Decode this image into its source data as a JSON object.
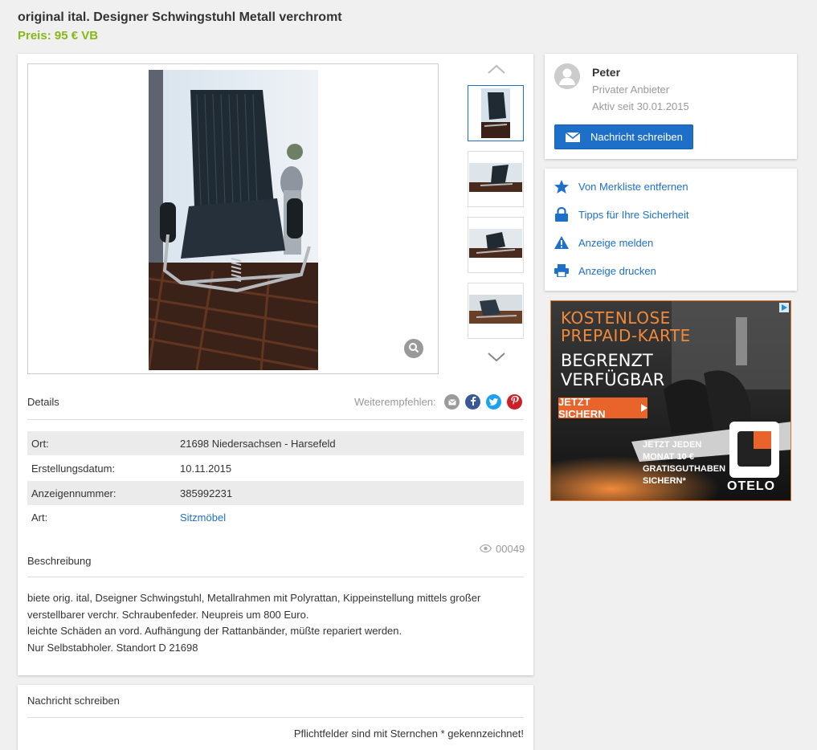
{
  "listing": {
    "title": "original ital. Designer Schwingstuhl Metall verchromt",
    "price": "Preis: 95 € VB"
  },
  "details": {
    "heading": "Details",
    "share_label": "Weiterempfehlen:",
    "rows": [
      {
        "label": "Ort:",
        "value": "21698 Niedersachsen - Harsefeld"
      },
      {
        "label": "Erstellungsdatum:",
        "value": "10.11.2015"
      },
      {
        "label": "Anzeigennummer:",
        "value": "385992231"
      },
      {
        "label": "Art:",
        "value": "Sitzmöbel"
      }
    ],
    "views": "00049"
  },
  "description": {
    "heading": "Beschreibung",
    "lines": [
      "biete orig. ital, Dseigner Schwingstuhl, Metallrahmen mit Polyrattan, Kippeinstellung mittels großer",
      "verstellbarer verchr. Schraubenfeder. Neupreis um 800 Euro.",
      "leichte Schäden an vord. Aufhängung der Rattanbänder, müßte repariert werden.",
      "Nur Selbstabholer. Standort D 21698"
    ]
  },
  "message_form": {
    "heading": "Nachricht schreiben",
    "required_note": "Pflichtfelder sind mit Sternchen * gekennzeichnet!"
  },
  "seller": {
    "name": "Peter",
    "type": "Privater Anbieter",
    "since": "Aktiv seit 30.01.2015",
    "button": "Nachricht schreiben"
  },
  "actions": [
    {
      "label": "Von Merkliste entfernen",
      "icon": "star-icon"
    },
    {
      "label": "Tipps für Ihre Sicherheit",
      "icon": "lock-icon"
    },
    {
      "label": "Anzeige melden",
      "icon": "warning-icon"
    },
    {
      "label": "Anzeige drucken",
      "icon": "printer-icon"
    }
  ],
  "ad": {
    "line1": "KOSTENLOSE",
    "line2": "PREPAID-KARTE",
    "line3": "BEGRENZT",
    "line4": "VERFÜGBAR",
    "cta": "JETZT SICHERN",
    "small1": "JETZT JEDEN",
    "small2": "MONAT 10 €",
    "small3": "GRATISGUTHABEN",
    "small4": "SICHERN*",
    "brand": "OTELO"
  },
  "colors": {
    "accent": "#1e6fc8",
    "price": "#86b817",
    "ad_orange": "#e8642a"
  }
}
